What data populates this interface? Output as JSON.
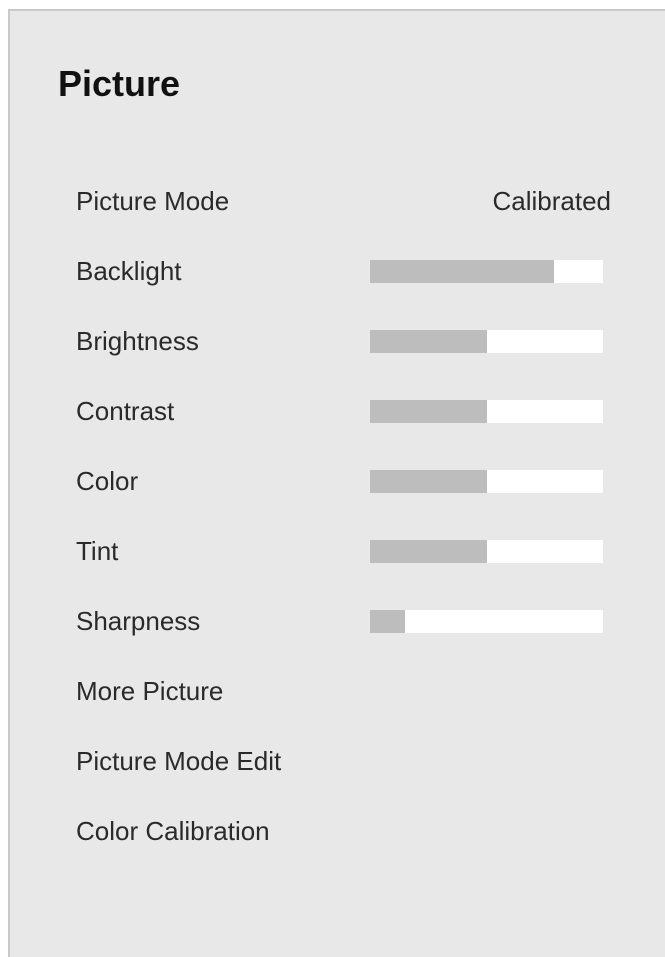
{
  "title": "Picture",
  "colors": {
    "panel_background": "#e8e8e8",
    "bar_fill": "#bdbdbd",
    "bar_track": "#ffffff"
  },
  "items": [
    {
      "label": "Picture Mode",
      "value": "Calibrated"
    },
    {
      "label": "Backlight",
      "level": 0.79
    },
    {
      "label": "Brightness",
      "level": 0.5
    },
    {
      "label": "Contrast",
      "level": 0.5
    },
    {
      "label": "Color",
      "level": 0.5
    },
    {
      "label": "Tint",
      "level": 0.5
    },
    {
      "label": "Sharpness",
      "level": 0.15
    },
    {
      "label": "More Picture"
    },
    {
      "label": "Picture Mode Edit"
    },
    {
      "label": "Color Calibration"
    }
  ]
}
